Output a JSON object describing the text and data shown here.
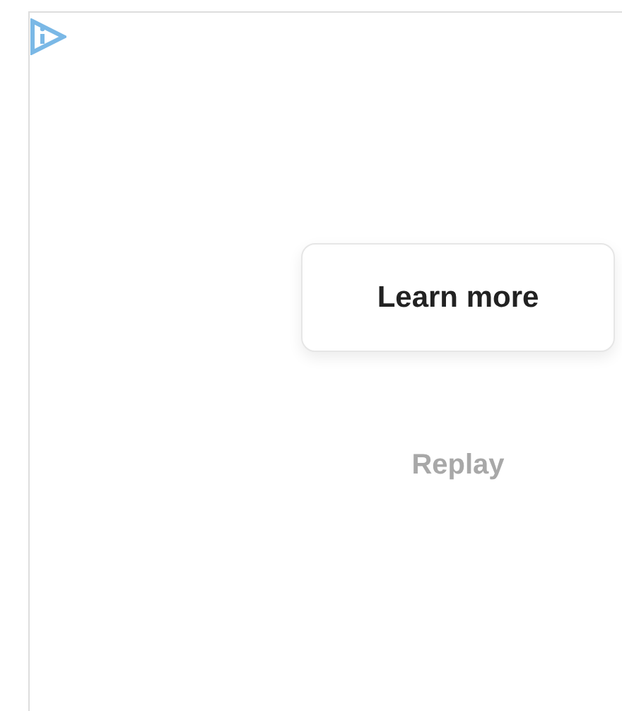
{
  "ad": {
    "buttons": [
      {
        "label": "Learn more",
        "kind": "primary"
      },
      {
        "label": "Replay",
        "kind": "secondary"
      }
    ]
  }
}
